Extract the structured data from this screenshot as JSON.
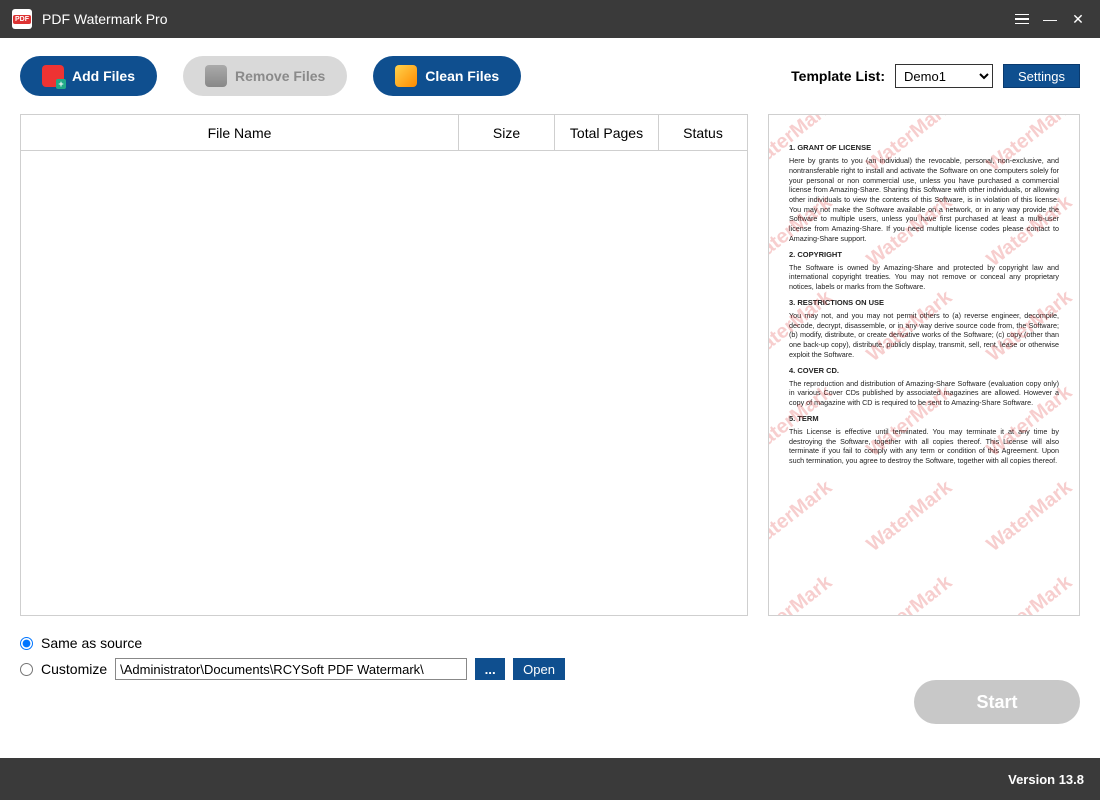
{
  "app": {
    "title": "PDF Watermark Pro",
    "version_label": "Version 13.8"
  },
  "toolbar": {
    "add_label": "Add Files",
    "remove_label": "Remove Files",
    "clean_label": "Clean Files"
  },
  "template": {
    "label": "Template List:",
    "selected": "Demo1",
    "settings_label": "Settings"
  },
  "table_headers": {
    "name": "File Name",
    "size": "Size",
    "pages": "Total Pages",
    "status": "Status"
  },
  "output": {
    "same_label": "Same as source",
    "customize_label": "Customize",
    "path": "\\Administrator\\Documents\\RCYSoft PDF Watermark\\",
    "open_label": "Open"
  },
  "start_label": "Start",
  "watermark_text": "WaterMark",
  "preview_doc": {
    "s1_title": "1. GRANT OF LICENSE",
    "s1_body": "Here by grants to you (an individual) the revocable, personal, non-exclusive, and nontransferable right to install and activate the Software on one computers solely for your personal or non commercial use, unless you have purchased a commercial license from Amazing-Share. Sharing this Software with other individuals, or allowing other individuals to view the contents of this Software, is in violation of this license. You may not make the Software available on a network, or in any way provide the Software to multiple users, unless you have first purchased at least a multi-user license from Amazing-Share. If you need multiple license codes please contact to Amazing-Share support.",
    "s2_title": "2. COPYRIGHT",
    "s2_body": "The Software is owned by Amazing-Share and protected by copyright law and international copyright treaties. You may not remove or conceal any proprietary notices, labels or marks from the Software.",
    "s3_title": "3. RESTRICTIONS ON USE",
    "s3_body": "You may not, and you may not permit others to (a) reverse engineer, decompile, decode, decrypt, disassemble, or in any way derive source code from, the Software; (b) modify, distribute, or create derivative works of the Software; (c) copy (other than one back-up copy), distribute, publicly display, transmit, sell, rent, lease or otherwise exploit the Software.",
    "s4_title": "4. COVER CD.",
    "s4_body": "The reproduction and distribution of Amazing-Share Software (evaluation copy only) in various Cover CDs published by associated magazines are allowed. However a copy of magazine with CD is required to be sent to Amazing-Share Software.",
    "s5_title": "5. TERM",
    "s5_body": "This License is effective until terminated. You may terminate it at any time by destroying the Software, together with all copies thereof. This License will also terminate if you fail to comply with any term or condition of this Agreement. Upon such termination, you agree to destroy the Software, together with all copies thereof."
  }
}
